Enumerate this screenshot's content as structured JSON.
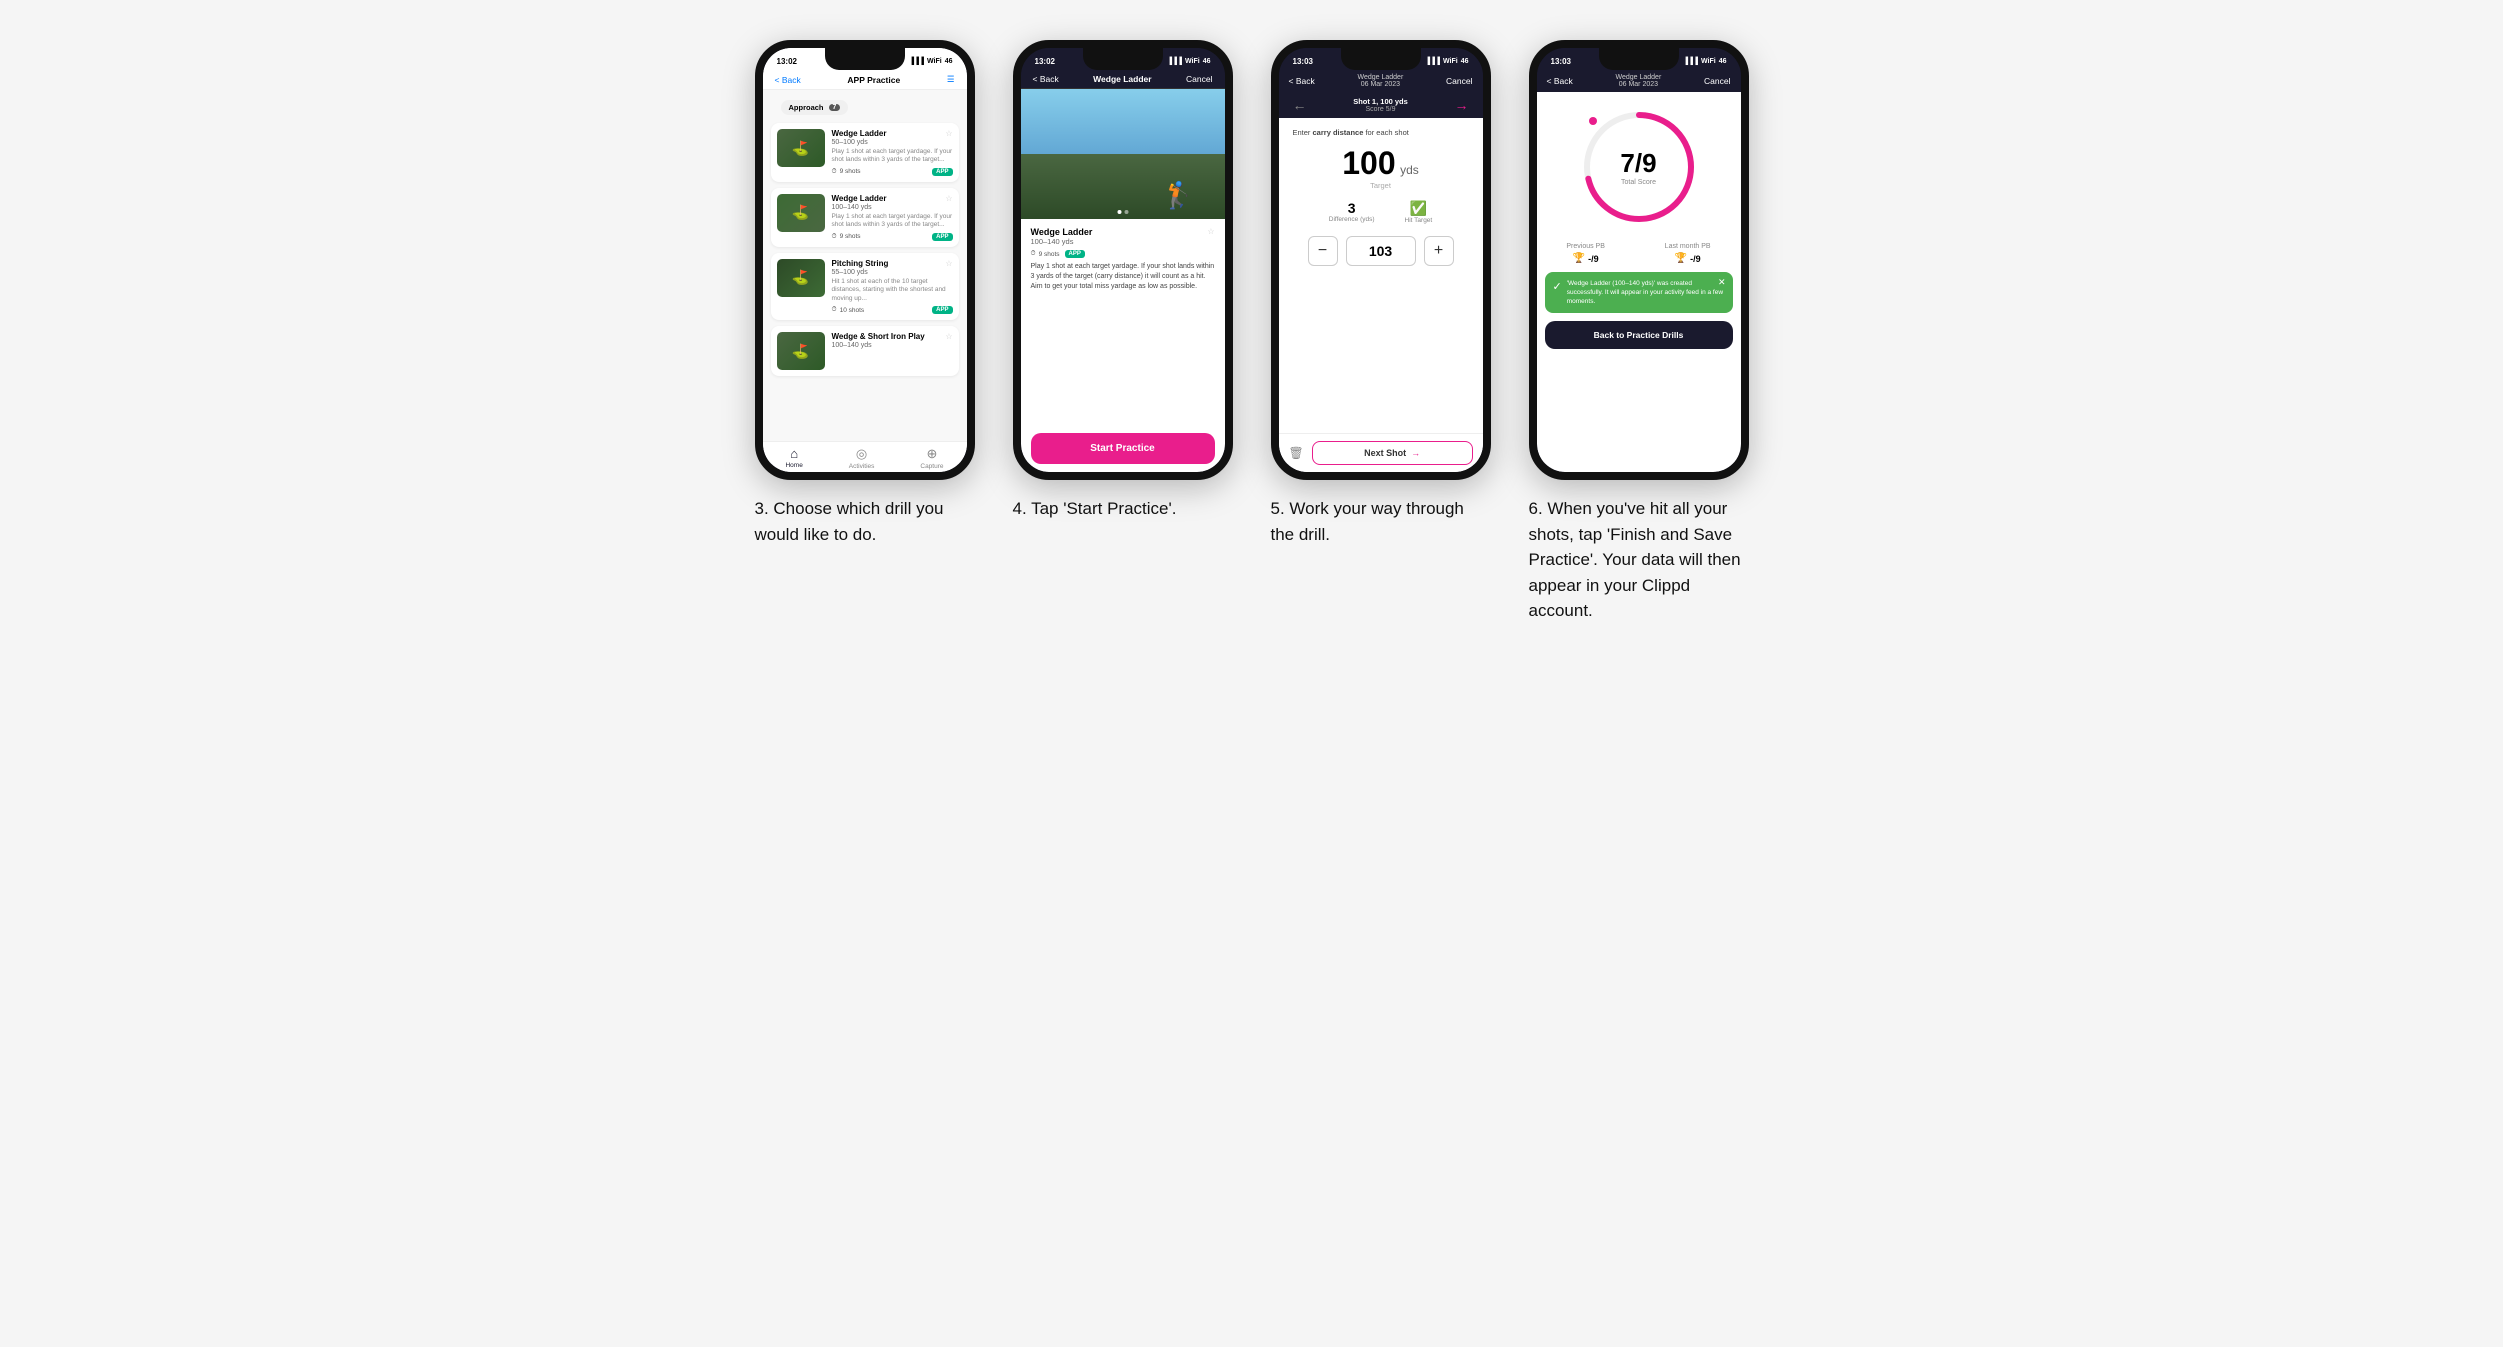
{
  "phones": [
    {
      "id": "phone1",
      "status_time": "13:02",
      "nav_back": "< Back",
      "nav_title": "APP Practice",
      "nav_right": "☰",
      "screen": "drill_list",
      "approach_label": "Approach",
      "approach_count": "7",
      "drills": [
        {
          "name": "Wedge Ladder",
          "yds": "50–100 yds",
          "desc": "Play 1 shot at each target yardage. If your shot lands within 3 yards of the target...",
          "shots": "9 shots",
          "badge": "APP",
          "color": "#2d5a27"
        },
        {
          "name": "Wedge Ladder",
          "yds": "100–140 yds",
          "desc": "Play 1 shot at each target yardage. If your shot lands within 3 yards of the target...",
          "shots": "9 shots",
          "badge": "APP",
          "color": "#4a6741"
        },
        {
          "name": "Pitching String",
          "yds": "55–100 yds",
          "desc": "Hit 1 shot at each of the 10 target distances, starting with the shortest and moving up...",
          "shots": "10 shots",
          "badge": "APP",
          "color": "#2d4a27"
        },
        {
          "name": "Wedge & Short Iron Play",
          "yds": "100–140 yds",
          "desc": "",
          "shots": "",
          "badge": "",
          "color": "#3d6b35"
        }
      ],
      "bottom_nav": [
        "Home",
        "Activities",
        "Capture"
      ]
    },
    {
      "id": "phone2",
      "status_time": "13:02",
      "nav_back": "< Back",
      "nav_title": "Wedge Ladder",
      "nav_cancel": "Cancel",
      "drill_name": "Wedge Ladder",
      "drill_yds": "100–140 yds",
      "shots": "9 shots",
      "badge": "APP",
      "description": "Play 1 shot at each target yardage. If your shot lands within 3 yards of the target (carry distance) it will count as a hit. Aim to get your total miss yardage as low as possible.",
      "start_btn": "Start Practice"
    },
    {
      "id": "phone3",
      "status_time": "13:03",
      "nav_back": "< Back",
      "nav_title_top": "Wedge Ladder",
      "nav_subtitle_top": "06 Mar 2023",
      "nav_cancel": "Cancel",
      "shot_label": "Shot 1, 100 yds",
      "score_label": "Score 5/9",
      "instruction": "Enter carry distance for each shot",
      "target_val": "100",
      "target_unit": "yds",
      "target_label": "Target",
      "difference": "3",
      "difference_label": "Difference (yds)",
      "hit_target_label": "Hit Target",
      "input_val": "103",
      "next_shot": "Next Shot"
    },
    {
      "id": "phone4",
      "status_time": "13:03",
      "nav_back": "< Back",
      "nav_title_top": "Wedge Ladder",
      "nav_subtitle_top": "06 Mar 2023",
      "nav_cancel": "Cancel",
      "score_big": "7/9",
      "score_label": "Total Score",
      "prev_pb_label": "Previous PB",
      "prev_pb_val": "-/9",
      "last_pb_label": "Last month PB",
      "last_pb_val": "-/9",
      "success_msg": "'Wedge Ladder (100–140 yds)' was created successfully. It will appear in your activity feed in a few moments.",
      "back_btn": "Back to Practice Drills"
    }
  ],
  "captions": [
    "3. Choose which\ndrill you would like\nto do.",
    "4. Tap 'Start Practice'.",
    "5. Work your way\nthrough the drill.",
    "6. When you've hit all\nyour shots, tap 'Finish\nand Save Practice'. Your\ndata will then appear in\nyour Clippd account."
  ]
}
